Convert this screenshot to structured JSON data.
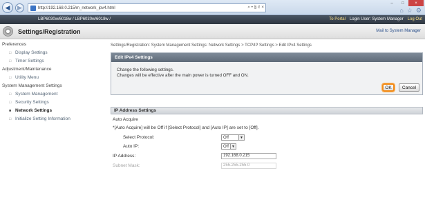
{
  "browser": {
    "url": "http://192.168.0.215/m_network_ipv4.html",
    "tools": "⌕ • § ć ×",
    "win_min": "–",
    "win_max": "□",
    "win_close": "×"
  },
  "device_header": {
    "model": "LBP6030w/6018w / LBP6030w/6018w /",
    "to_portal": "To Portal",
    "login_user": "Login User: System Manager",
    "log_out": "Log Out"
  },
  "settings_bar": {
    "title": "Settings/Registration",
    "mail_link": "Mail to System Manager"
  },
  "sidebar": {
    "items": [
      {
        "label": "Preferences"
      },
      {
        "label": "Display Settings"
      },
      {
        "label": "Timer Settings"
      },
      {
        "label": "Adjustment/Maintenance"
      },
      {
        "label": "Utility Menu"
      },
      {
        "label": "System Management Settings"
      },
      {
        "label": "System Management"
      },
      {
        "label": "Security Settings"
      },
      {
        "label": "Network Settings"
      },
      {
        "label": "Initialize Setting Information"
      }
    ]
  },
  "main": {
    "breadcrumb": "Settings/Registration: System Management Settings: Network Settings > TCP/IP Settings > Edit IPv4 Settings",
    "panel_title": "Edit IPv4 Settings",
    "msg_line1": "Change the following settings.",
    "msg_line2": "Changes will be effective after the main power is turned OFF and ON.",
    "ok_label": "OK",
    "cancel_label": "Cancel",
    "ip_section_title": "IP Address Settings",
    "auto_acquire": "Auto Acquire",
    "auto_note": "*[Auto Acquire] will be Off if [Select Protocol] and [Auto IP] are set to [Off].",
    "select_protocol_label": "Select Protocol:",
    "select_protocol_value": "Off",
    "auto_ip_label": "Auto IP:",
    "auto_ip_value": "Off",
    "ip_address_label": "IP Address:",
    "ip_address_value": "192.168.0.215",
    "subnet_label": "Subnet Mask:",
    "subnet_value": "255.255.255.0"
  }
}
